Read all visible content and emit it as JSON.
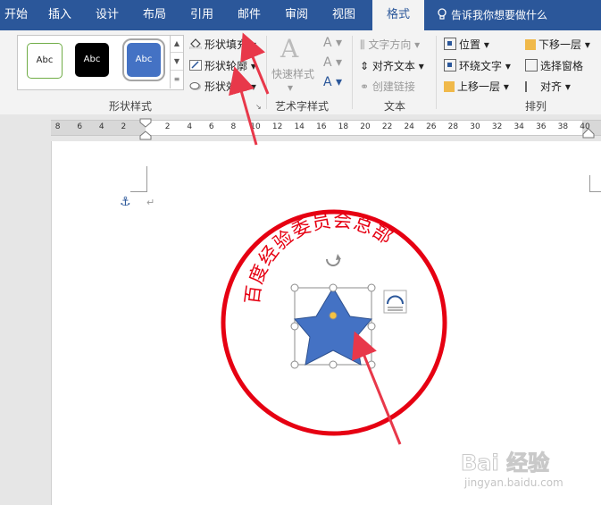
{
  "tabs": [
    {
      "label": "开始"
    },
    {
      "label": "插入"
    },
    {
      "label": "设计"
    },
    {
      "label": "布局"
    },
    {
      "label": "引用"
    },
    {
      "label": "邮件"
    },
    {
      "label": "审阅"
    },
    {
      "label": "视图"
    },
    {
      "label": "格式"
    }
  ],
  "tell_me": "告诉我你想要做什么",
  "shape_styles": {
    "swatches": [
      {
        "label": "Abc",
        "style": "outline-green"
      },
      {
        "label": "Abc",
        "style": "black"
      },
      {
        "label": "Abc",
        "style": "blue"
      }
    ],
    "fill": "形状填充",
    "outline": "形状轮廓",
    "effects": "形状效果",
    "group_label": "形状样式"
  },
  "wordart": {
    "quick_styles": "快速样式",
    "group_label": "艺术字样式"
  },
  "text": {
    "direction": "文字方向",
    "align": "对齐文本",
    "link": "创建链接",
    "group_label": "文本"
  },
  "arrange": {
    "position": "位置",
    "wrap": "环绕文字",
    "forward": "上移一层",
    "backward": "下移一层",
    "selection_pane": "选择窗格",
    "align": "对齐",
    "group_label": "排列"
  },
  "ruler": {
    "numbers": [
      "8",
      "6",
      "4",
      "2",
      "2",
      "4",
      "6",
      "8",
      "10",
      "12",
      "14",
      "16",
      "18",
      "20",
      "22",
      "24",
      "26",
      "28",
      "30",
      "32",
      "34",
      "36",
      "38",
      "40"
    ]
  },
  "document": {
    "seal_text": "百度经验委员会总部",
    "colors": {
      "seal": "#e60012",
      "star": "#4472c4",
      "arrow": "#e8384a",
      "accent": "#2b579a"
    }
  },
  "watermark": {
    "logo": "Bai 经验",
    "url": "jingyan.baidu.com"
  }
}
